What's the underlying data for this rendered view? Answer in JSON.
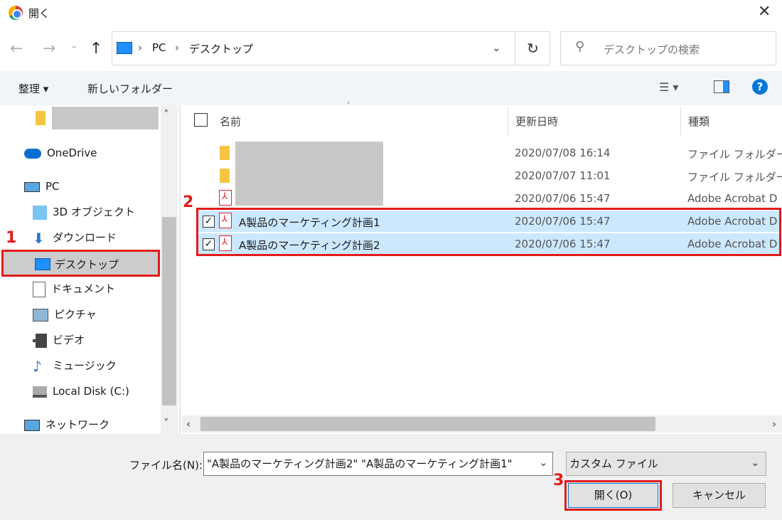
{
  "window": {
    "title": "開く"
  },
  "nav": {
    "back": "←",
    "forward": "→",
    "history": "⌄",
    "up": "↑",
    "breadcrumb": [
      "PC",
      "デスクトップ"
    ],
    "refresh": "↻",
    "search_placeholder": "デスクトップの検索"
  },
  "toolbar": {
    "organize": "整理 ▾",
    "new_folder": "新しいフォルダー"
  },
  "sidebar": {
    "items": [
      {
        "label": "",
        "icon": "folder-icon"
      },
      {
        "label": "OneDrive",
        "icon": "cloud-icon"
      },
      {
        "label": "PC",
        "icon": "computer-icon"
      },
      {
        "label": "3D オブジェクト",
        "icon": "cube-icon"
      },
      {
        "label": "ダウンロード",
        "icon": "download-icon"
      },
      {
        "label": "デスクトップ",
        "icon": "desktop-icon"
      },
      {
        "label": "ドキュメント",
        "icon": "document-icon"
      },
      {
        "label": "ピクチャ",
        "icon": "picture-icon"
      },
      {
        "label": "ビデオ",
        "icon": "video-icon"
      },
      {
        "label": "ミュージック",
        "icon": "music-icon"
      },
      {
        "label": "Local Disk (C:)",
        "icon": "drive-icon"
      },
      {
        "label": "ネットワーク",
        "icon": "network-icon"
      }
    ]
  },
  "columns": {
    "name": "名前",
    "date": "更新日時",
    "type": "種類"
  },
  "files": [
    {
      "name": "",
      "date": "2020/07/08 16:14",
      "type": "ファイル フォルダー",
      "icon": "folder-icon"
    },
    {
      "name": "",
      "date": "2020/07/07 11:01",
      "type": "ファイル フォルダー",
      "icon": "folder-icon"
    },
    {
      "name": "",
      "date": "2020/07/06 15:47",
      "type": "Adobe Acrobat D",
      "icon": "pdf-icon"
    },
    {
      "name": "A製品のマーケティング計画1",
      "date": "2020/07/06 15:47",
      "type": "Adobe Acrobat D",
      "icon": "pdf-icon",
      "checked": true
    },
    {
      "name": "A製品のマーケティング計画2",
      "date": "2020/07/06 15:47",
      "type": "Adobe Acrobat D",
      "icon": "pdf-icon",
      "checked": true
    }
  ],
  "steps": [
    "1",
    "2",
    "3"
  ],
  "footer": {
    "filename_label": "ファイル名(N):",
    "filename_value": "\"A製品のマーケティング計画2\" \"A製品のマーケティング計画1\"",
    "filter_value": "カスタム ファイル",
    "open_button": "開く(O)",
    "cancel_button": "キャンセル"
  },
  "colors": {
    "accent": "#e21b1b",
    "selection": "#cce8ff"
  }
}
